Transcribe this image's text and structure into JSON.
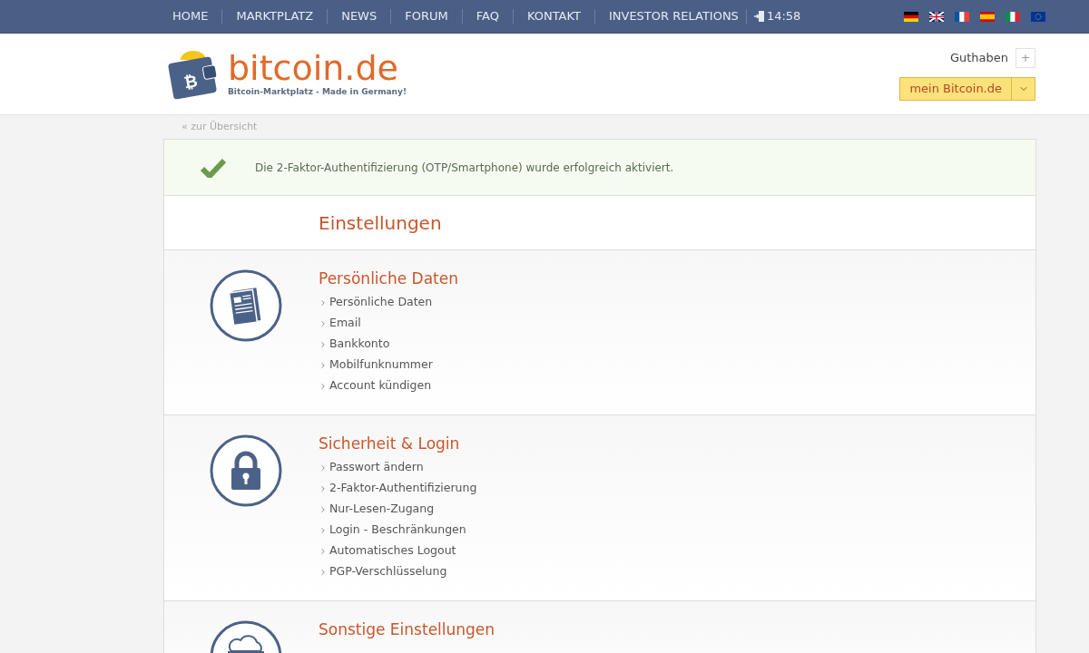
{
  "nav": {
    "items": [
      "HOME",
      "MARKTPLATZ",
      "NEWS",
      "FORUM",
      "FAQ",
      "KONTAKT",
      "INVESTOR RELATIONS"
    ],
    "time": "14:58",
    "flags": [
      {
        "kind": "german"
      },
      {
        "kind": "british"
      },
      {
        "kind": "french"
      },
      {
        "kind": "spanish"
      },
      {
        "kind": "italian"
      },
      {
        "kind": "european"
      }
    ]
  },
  "header": {
    "logo_symbol": "₿",
    "logo_text": "bitcoin.de",
    "tagline": "Bitcoin-Marktplatz - Made in Germany!",
    "balance_label": "Guthaben",
    "balance_toggle": "+",
    "account_button": "mein Bitcoin.de"
  },
  "breadcrumb": "« zur Übersicht",
  "alert": {
    "message": "Die 2-Faktor-Authentifizierung (OTP/Smartphone) wurde erfolgreich aktiviert."
  },
  "title": "Einstellungen",
  "sections": [
    {
      "kind": "document",
      "title": "Persönliche Daten",
      "links": [
        "Persönliche Daten",
        "Email",
        "Bankkonto",
        "Mobilfunknummer",
        "Account kündigen"
      ]
    },
    {
      "kind": "lock",
      "title": "Sicherheit & Login",
      "links": [
        "Passwort ändern",
        "2-Faktor-Authentifizierung",
        "Nur-Lesen-Zugang",
        "Login - Beschränkungen",
        "Automatisches Logout",
        "PGP-Verschlüsselung"
      ]
    },
    {
      "kind": "cloud",
      "title": "Sonstige Einstellungen"
    }
  ]
}
